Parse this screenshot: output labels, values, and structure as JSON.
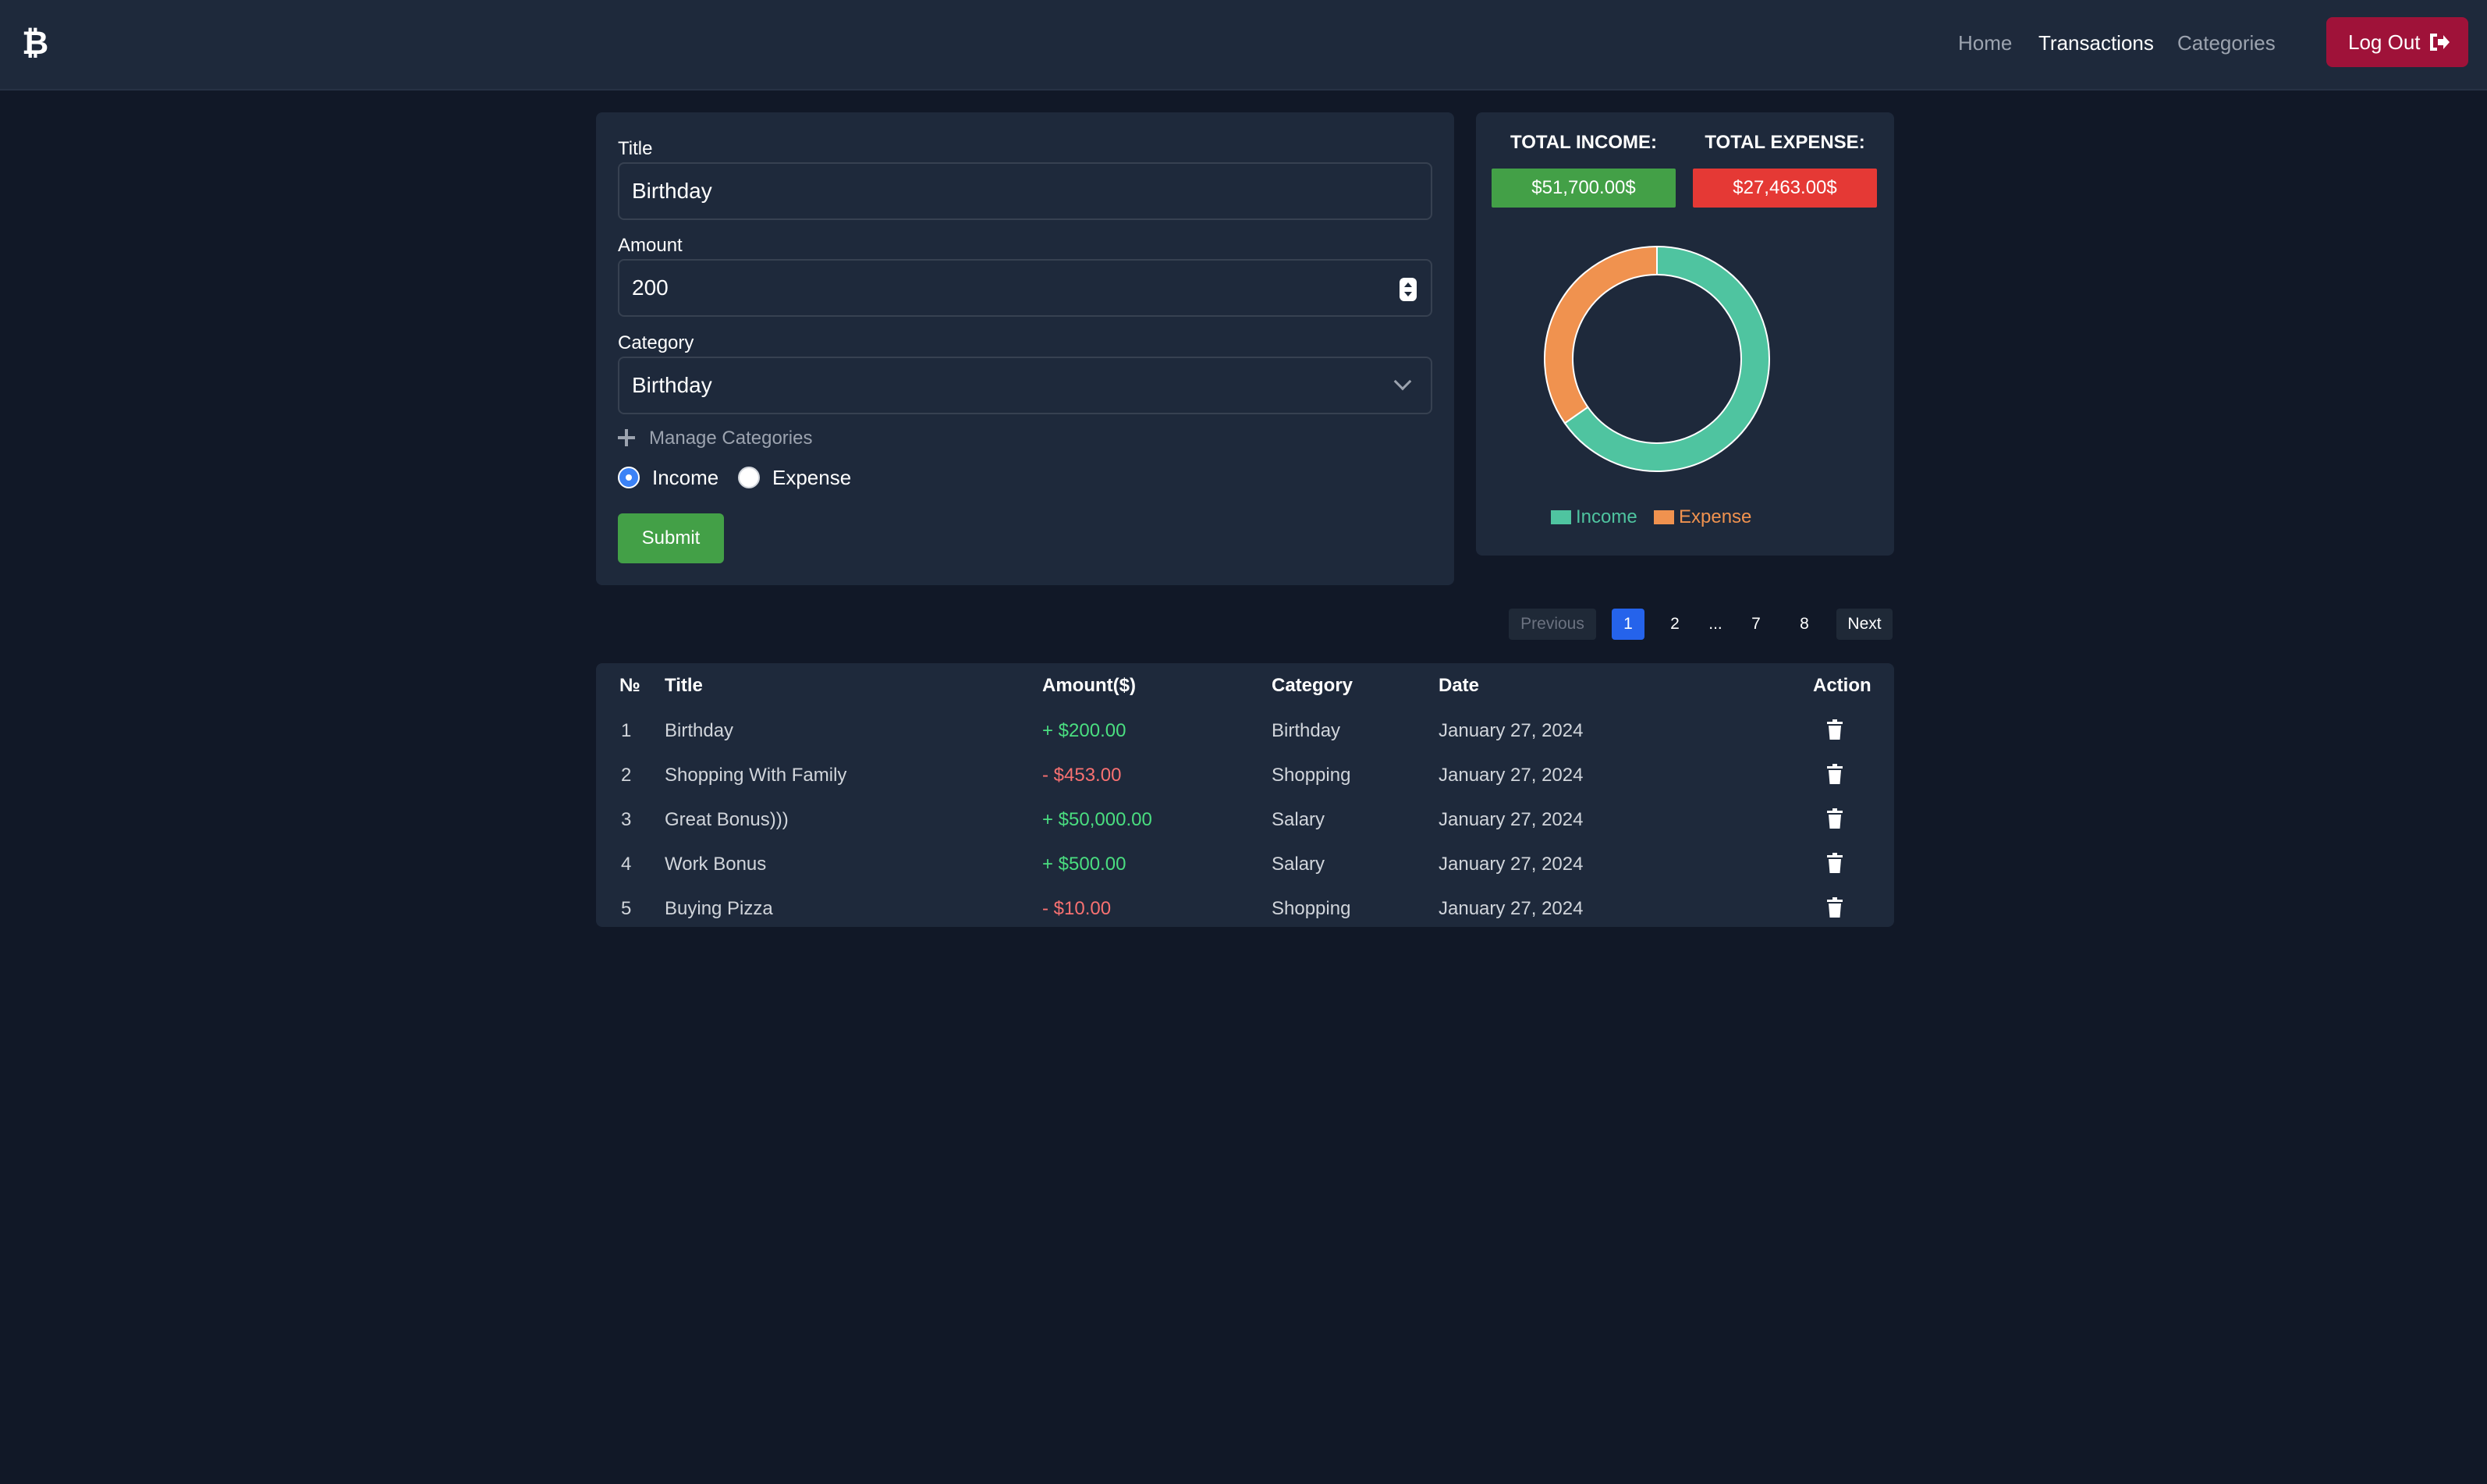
{
  "header": {
    "logo_icon": "bitcoin-icon",
    "logo_glyph": "₿",
    "nav": [
      {
        "label": "Home",
        "active": false
      },
      {
        "label": "Transactions",
        "active": true
      },
      {
        "label": "Categories",
        "active": false
      }
    ],
    "logout_label": "Log Out",
    "logout_icon": "sign-out-icon"
  },
  "form": {
    "title_label": "Title",
    "title_value": "Birthday",
    "amount_label": "Amount",
    "amount_value": "200",
    "category_label": "Category",
    "category_value": "Birthday",
    "manage_categories_label": "Manage Categories",
    "type_options": [
      {
        "label": "Income",
        "checked": true
      },
      {
        "label": "Expense",
        "checked": false
      }
    ],
    "submit_label": "Submit"
  },
  "totals": {
    "income_title": "TOTAL INCOME:",
    "income_value": "$51,700.00$",
    "expense_title": "TOTAL EXPENSE:",
    "expense_value": "$27,463.00$",
    "colors": {
      "income_badge": "#43a047",
      "expense_badge": "#e53935"
    }
  },
  "chart_data": {
    "type": "pie",
    "style": "doughnut",
    "categories": [
      "Income",
      "Expense"
    ],
    "values": [
      51700,
      27463
    ],
    "colors": [
      "#4fc4a0",
      "#f0924f"
    ],
    "legend": "bottom"
  },
  "pagination": {
    "previous_label": "Previous",
    "pages": [
      "1",
      "2",
      "...",
      "7",
      "8"
    ],
    "current_page": "1",
    "next_label": "Next"
  },
  "table": {
    "headers": [
      "№",
      "Title",
      "Amount($)",
      "Category",
      "Date",
      "Action"
    ],
    "rows": [
      {
        "n": "1",
        "title": "Birthday",
        "amount": "+ $200.00",
        "sign": "pos",
        "category": "Birthday",
        "date": "January 27, 2024"
      },
      {
        "n": "2",
        "title": "Shopping With Family",
        "amount": "- $453.00",
        "sign": "neg",
        "category": "Shopping",
        "date": "January 27, 2024"
      },
      {
        "n": "3",
        "title": "Great Bonus)))",
        "amount": "+ $50,000.00",
        "sign": "pos",
        "category": "Salary",
        "date": "January 27, 2024"
      },
      {
        "n": "4",
        "title": "Work Bonus",
        "amount": "+ $500.00",
        "sign": "pos",
        "category": "Salary",
        "date": "January 27, 2024"
      },
      {
        "n": "5",
        "title": "Buying Pizza",
        "amount": "- $10.00",
        "sign": "neg",
        "category": "Shopping",
        "date": "January 27, 2024"
      }
    ],
    "action_icon": "trash-icon"
  }
}
